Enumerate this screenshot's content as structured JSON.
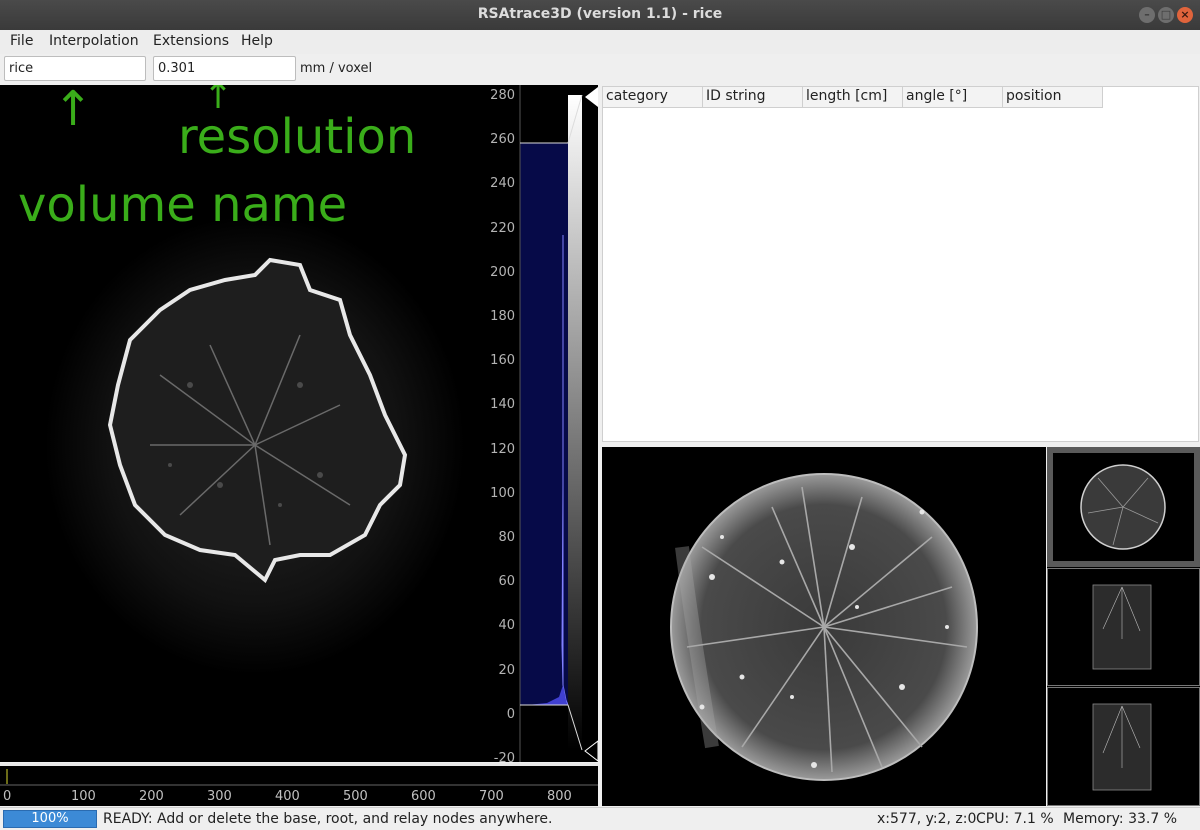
{
  "window": {
    "title": "RSAtrace3D (version 1.1) - rice"
  },
  "menu": [
    "File",
    "Interpolation",
    "Extensions",
    "Help"
  ],
  "toolbar": {
    "volume_name": "rice",
    "resolution": "0.301",
    "unit": "mm / voxel"
  },
  "annotations": {
    "volume_name": "volume name",
    "resolution": "resolution",
    "arrow": "↑"
  },
  "histogram": {
    "ticks": [
      "280",
      "260",
      "240",
      "220",
      "200",
      "180",
      "160",
      "140",
      "120",
      "100",
      "80",
      "60",
      "40",
      "20",
      "0",
      "-20"
    ]
  },
  "bottom_axis": {
    "ticks": [
      "0",
      "100",
      "200",
      "300",
      "400",
      "500",
      "600",
      "700",
      "800"
    ]
  },
  "table": {
    "columns": [
      "category",
      "ID string",
      "length [cm]",
      "angle [°]",
      "position"
    ]
  },
  "status": {
    "progress": "100%",
    "message": "READY: Add or delete the base, root, and relay nodes anywhere.",
    "coords": "x:577, y:2, z:0",
    "cpu": "CPU: 7.1 %",
    "memory": "Memory: 33.7 %"
  },
  "colors": {
    "annotation": "#3aad1a",
    "histogram_fill": "#060a48",
    "progress": "#3c8ad6"
  },
  "icons": [
    "minimize-icon",
    "maximize-icon",
    "close-icon"
  ]
}
